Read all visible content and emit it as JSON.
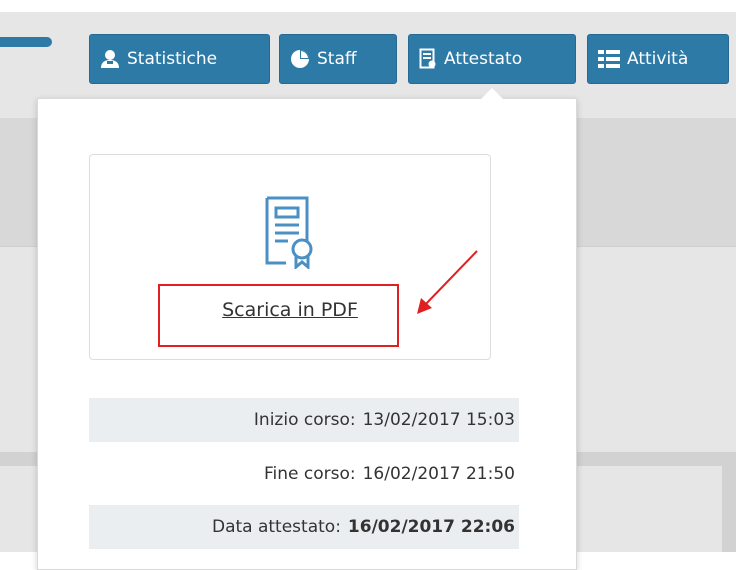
{
  "tabs": [
    {
      "label": "Statistiche",
      "icon": "user-icon"
    },
    {
      "label": "Staff",
      "icon": "pie-chart-icon"
    },
    {
      "label": "Attestato",
      "icon": "certificate-icon"
    },
    {
      "label": "Attività",
      "icon": "list-icon"
    }
  ],
  "certificate": {
    "icon": "certificate-icon",
    "download_label": "Scarica in PDF"
  },
  "details": [
    {
      "label": "Inizio corso:",
      "value": "13/02/2017 15:03"
    },
    {
      "label": "Fine corso:",
      "value": "16/02/2017 21:50"
    },
    {
      "label": "Data attestato:",
      "value": "16/02/2017 22:06"
    }
  ],
  "colors": {
    "accent": "#2e7aa7",
    "annotation": "#e02020",
    "icon": "#4a90c4",
    "row_shade": "#ebeef1"
  }
}
